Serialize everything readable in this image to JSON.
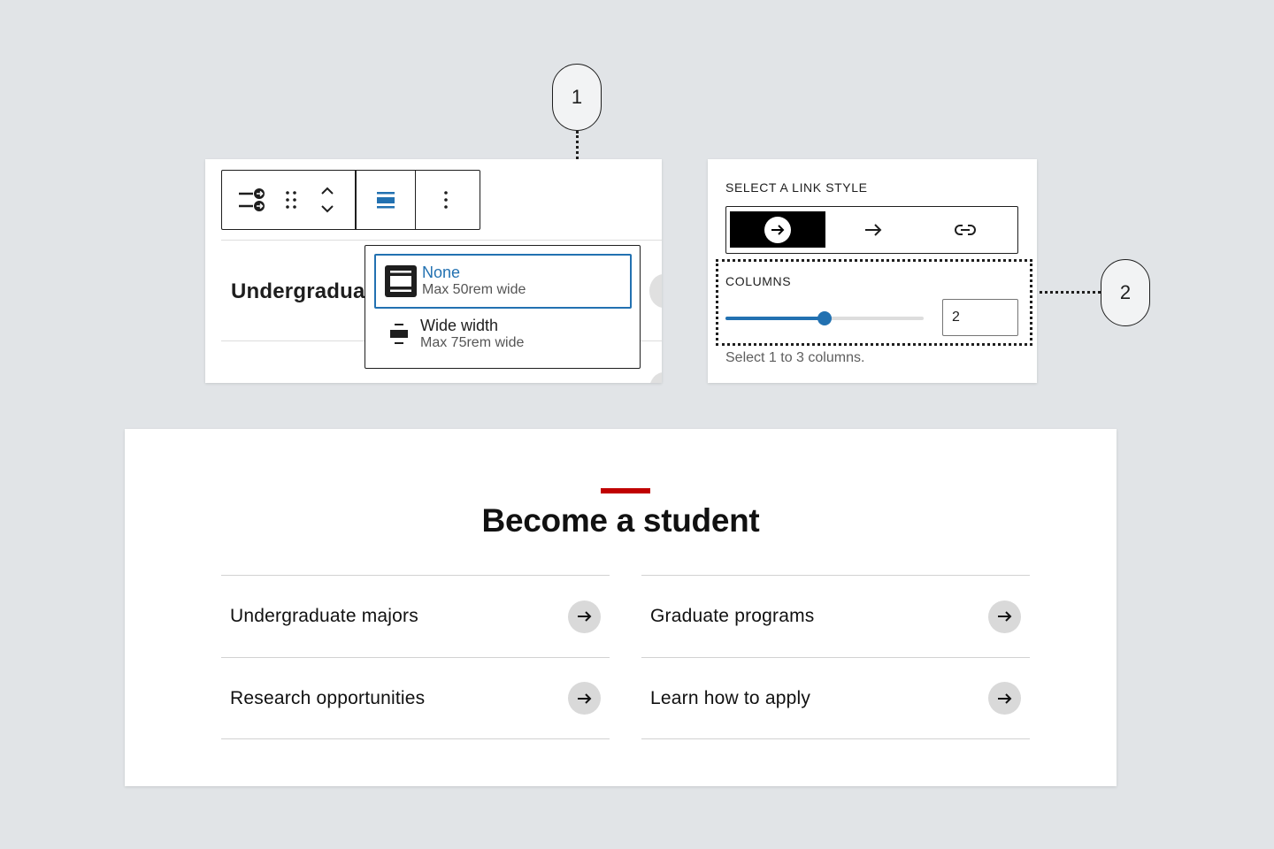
{
  "callouts": {
    "one": "1",
    "two": "2"
  },
  "block_editor": {
    "heading_preview": "Undergradua",
    "width_options": [
      {
        "title": "None",
        "subtitle": "Max 50rem wide",
        "selected": true
      },
      {
        "title": "Wide width",
        "subtitle": "Max 75rem wide",
        "selected": false
      }
    ]
  },
  "settings": {
    "link_style_label": "SELECT A LINK STYLE",
    "link_styles": [
      "arrow-circle-icon",
      "arrow-right-icon",
      "link-icon"
    ],
    "link_style_selected": 0,
    "columns_label": "COLUMNS",
    "columns_value": "2",
    "columns_min": 1,
    "columns_max": 3,
    "columns_help": "Select 1 to 3 columns."
  },
  "card": {
    "heading": "Become a student",
    "accent_color": "#c00000",
    "links": [
      {
        "label": "Undergraduate majors"
      },
      {
        "label": "Graduate programs"
      },
      {
        "label": "Research opportunities"
      },
      {
        "label": "Learn how to apply"
      }
    ]
  },
  "colors": {
    "primary": "#2271b1",
    "text": "#1e1e1e",
    "background": "#e1e4e7"
  }
}
